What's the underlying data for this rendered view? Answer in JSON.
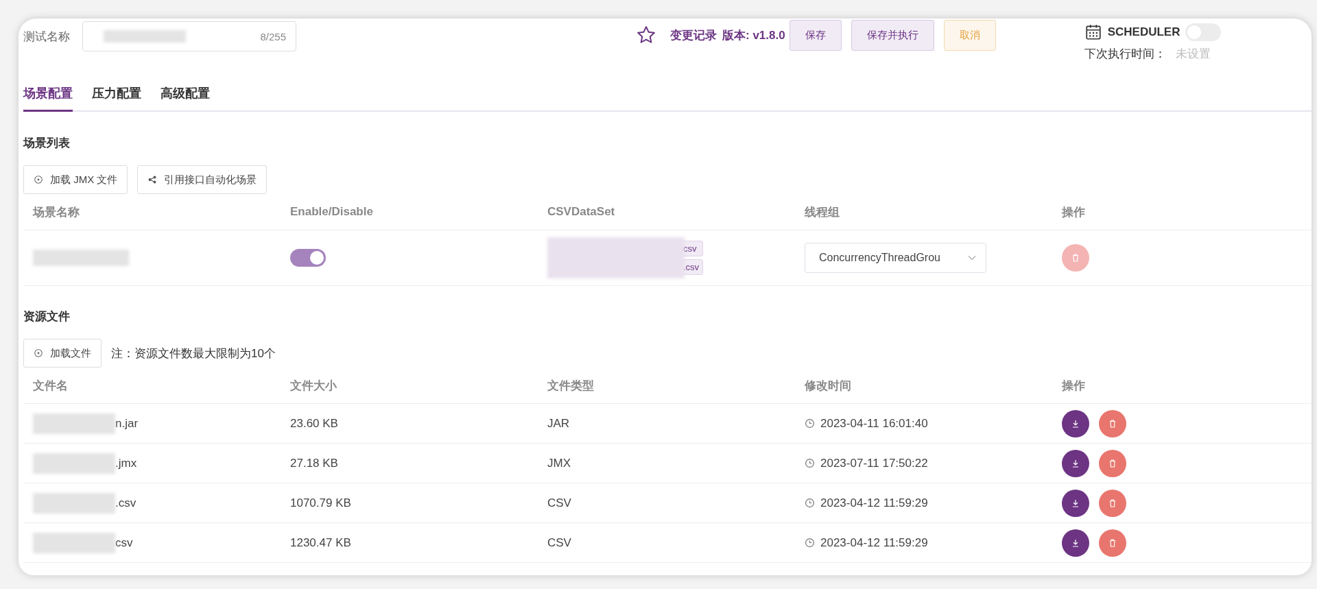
{
  "test_name": {
    "label": "测试名称",
    "counter": "8/255"
  },
  "header_actions": {
    "changelog": "变更记录",
    "version": "版本: v1.8.0",
    "buttons": [
      {
        "label": "保存",
        "kind": "primary"
      },
      {
        "label": "保存并执行",
        "kind": "primary"
      },
      {
        "label": "取消",
        "kind": "warning"
      }
    ]
  },
  "scheduler": {
    "label": "SCHEDULER",
    "on": false,
    "next_run_label": "下次执行时间：",
    "next_run_value": "未设置"
  },
  "tabs": [
    {
      "label": "场景配置",
      "selected": true
    },
    {
      "label": "压力配置",
      "selected": false
    },
    {
      "label": "高级配置",
      "selected": false
    }
  ],
  "scenario_section": {
    "title": "场景列表",
    "buttons": [
      {
        "label": "加载 JMX 文件",
        "kind": "load"
      },
      {
        "label": "引用接口自动化场景",
        "kind": "share"
      }
    ],
    "columns": [
      "场景名称",
      "Enable/Disable",
      "CSVDataSet",
      "线程组",
      "操作"
    ],
    "rows": [
      {
        "enabled": true,
        "csv_files": [
          "csv",
          ".csv"
        ],
        "thread_group": "ConcurrencyThreadGrou",
        "delete_disabled": true
      }
    ]
  },
  "resource_section": {
    "title": "资源文件",
    "button": "加载文件",
    "note": "注：资源文件数最大限制为10个",
    "columns": [
      "文件名",
      "文件大小",
      "文件类型",
      "修改时间",
      "操作"
    ],
    "rows": [
      {
        "name": "n.jar",
        "size": "23.60 KB",
        "type": "JAR",
        "modified": "2023-04-11 16:01:40"
      },
      {
        "name": ".jmx",
        "size": "27.18 KB",
        "type": "JMX",
        "modified": "2023-07-11 17:50:22"
      },
      {
        "name": ".csv",
        "size": "1070.79 KB",
        "type": "CSV",
        "modified": "2023-04-12 11:59:29"
      },
      {
        "name": "csv",
        "size": "1230.47 KB",
        "type": "CSV",
        "modified": "2023-04-12 11:59:29"
      }
    ]
  }
}
